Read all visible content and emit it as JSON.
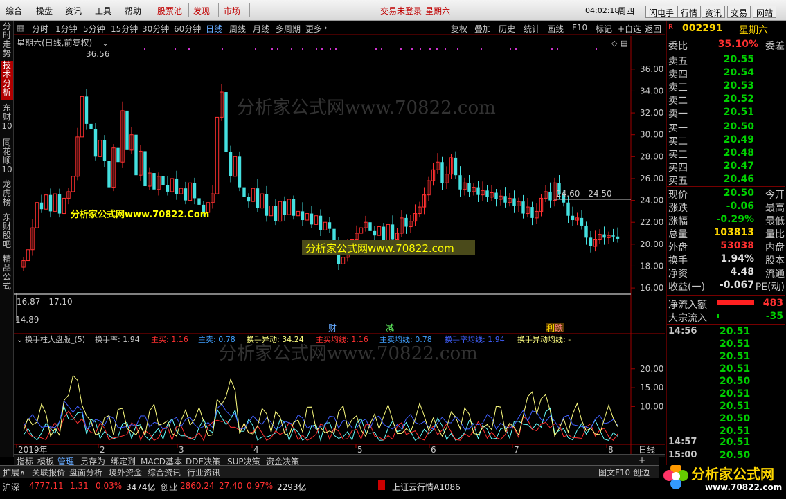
{
  "menu": {
    "items": [
      "综合",
      "操盘",
      "资讯",
      "工具",
      "帮助"
    ],
    "red_items": [
      "股票池",
      "发现",
      "市场"
    ],
    "login": "交易未登录",
    "login2": "星期六",
    "time": "04:02:18",
    "weekday": "周四",
    "buttons": [
      "闪电手",
      "行情",
      "资讯",
      "交易",
      "网站"
    ]
  },
  "left_tabs": [
    "分时走势",
    "技术分析",
    "东财10",
    "同花顺10",
    "龙虎榜",
    "东财股吧",
    "精品公式"
  ],
  "periods": [
    "分时",
    "1分钟",
    "5分钟",
    "15分钟",
    "30分钟",
    "60分钟",
    "日线",
    "周线",
    "月线",
    "多周期",
    "更多"
  ],
  "tools": [
    "复权",
    "叠加",
    "历史",
    "统计",
    "画线",
    "F10",
    "标记",
    "+自选",
    "返回"
  ],
  "chart": {
    "title": "星期六(日线,前复权)",
    "max_label": "36.56",
    "min_label": "14.89",
    "range1": "24.60 - 24.50",
    "range2": "16.87 - 17.10",
    "y_ticks": [
      "36.00",
      "34.00",
      "32.00",
      "30.00",
      "28.00",
      "26.00",
      "24.00",
      "22.00",
      "20.00",
      "18.00",
      "16.00"
    ],
    "markers": [
      "财",
      "减",
      "利",
      "跌"
    ],
    "watermark": "分析家公式网www.70822.com",
    "watermark2": "分析家公式网www.70822.Com",
    "x_ticks": [
      "2019年",
      "2",
      "3",
      "4",
      "5",
      "6",
      "7",
      "8"
    ],
    "period_label": "日线"
  },
  "indicator": {
    "name": "换手柱大盘版_(5)",
    "items": [
      "换手率: 1.94",
      "主买: 1.16",
      "主卖: 0.78",
      "换手异动: 34.24",
      "主买均线: 1.16",
      "主卖均线: 0.78",
      "换手率均线: 1.94",
      "换手异动均线: -"
    ],
    "y_ticks": [
      "20.00",
      "15.00",
      "10.00"
    ]
  },
  "right": {
    "code": "002291",
    "name": "星期六",
    "webi_label": "委比",
    "webi_val": "35.10%",
    "wecha": "委差",
    "sells": [
      [
        "卖五",
        "20.55"
      ],
      [
        "卖四",
        "20.54"
      ],
      [
        "卖三",
        "20.53"
      ],
      [
        "卖二",
        "20.52"
      ],
      [
        "卖一",
        "20.51"
      ]
    ],
    "buys": [
      [
        "买一",
        "20.50"
      ],
      [
        "买二",
        "20.49"
      ],
      [
        "买三",
        "20.48"
      ],
      [
        "买四",
        "20.47"
      ],
      [
        "买五",
        "20.46"
      ]
    ],
    "stats": [
      [
        "现价",
        "20.50",
        "今开"
      ],
      [
        "涨跌",
        "-0.06",
        "最高"
      ],
      [
        "涨幅",
        "-0.29%",
        "最低"
      ],
      [
        "总量",
        "103813",
        "量比"
      ],
      [
        "外盘",
        "53038",
        "内盘"
      ],
      [
        "换手",
        "1.94%",
        "股本"
      ],
      [
        "净资",
        "4.48",
        "流通"
      ],
      [
        "收益(一)",
        "-0.067",
        "PE(动)"
      ]
    ],
    "netflow_label": "净流入额",
    "netflow_val": "483",
    "block_label": "大宗流入",
    "block_val": "-35",
    "ticks": [
      [
        "14:56",
        "20.51"
      ],
      [
        "",
        "20.51"
      ],
      [
        "",
        "20.51"
      ],
      [
        "",
        "20.51"
      ],
      [
        "",
        "20.50"
      ],
      [
        "",
        "20.51"
      ],
      [
        "",
        "20.51"
      ],
      [
        "",
        "20.50"
      ],
      [
        "",
        "20.51"
      ],
      [
        "14:57",
        "20.51"
      ],
      [
        "15:00",
        "20.50"
      ]
    ]
  },
  "bottom_tabs": [
    "指标",
    "模板",
    "管理",
    "另存为",
    "绑定到",
    "MACD基本",
    "DDE决策",
    "SUP决策",
    "资金决策"
  ],
  "taskbar": [
    "扩展∧",
    "关联报价",
    "盘面分析",
    "境外资金",
    "综合资讯",
    "行业资讯"
  ],
  "taskbar_right": [
    "图文F10",
    "创边"
  ],
  "status": {
    "sh_label": "沪深",
    "sh_val": "4777.11",
    "sh_chg": "1.31",
    "sh_pct": "0.03%",
    "sh_amt": "3474亿",
    "cy_label": "创业",
    "cy_val": "2860.24",
    "cy_chg": "27.40",
    "cy_pct": "0.97%",
    "cy_amt": "2293亿",
    "news": "上证云行情A1086",
    "logo": "分析家公式网",
    "logo_url": "www.70822.com"
  },
  "chart_data": {
    "type": "candlestick",
    "title": "星期六(日线,前复权)",
    "ylim": [
      15.5,
      37
    ],
    "closes": [
      18.5,
      19.5,
      21.5,
      23.8,
      23.2,
      24.5,
      23.0,
      24.6,
      22.8,
      24.2,
      24.8,
      26.2,
      29.8,
      33.5,
      31.0,
      30.5,
      28.0,
      29.5,
      27.6,
      25.2,
      28.8,
      27.5,
      32.2,
      28.6,
      30.0,
      26.3,
      28.5,
      25.3,
      26.5,
      25.0,
      26.2,
      25.4,
      24.8,
      26.0,
      24.6,
      25.1,
      24.0,
      25.6,
      24.2,
      23.6,
      22.9,
      23.8,
      24.6,
      31.6,
      33.9,
      28.4,
      26.2,
      28.0,
      25.2,
      24.3,
      23.9,
      25.1,
      23.3,
      24.6,
      22.6,
      23.5,
      22.1,
      23.9,
      22.7,
      24.1,
      22.6,
      23.0,
      22.2,
      22.8,
      21.8,
      22.6,
      21.3,
      22.0,
      21.4,
      20.3,
      18.2,
      18.8,
      19.6,
      20.4,
      21.0,
      21.5,
      22.0,
      21.2,
      20.8,
      21.6,
      20.2,
      21.8,
      20.4,
      21.0,
      22.4,
      21.6,
      22.1,
      22.8,
      23.4,
      24.5,
      25.8,
      26.8,
      27.5,
      25.6,
      26.4,
      27.9,
      26.3,
      25.0,
      25.6,
      24.8,
      25.2,
      24.5,
      24.9,
      24.3,
      24.7,
      24.1,
      24.4,
      23.8,
      24.2,
      23.5,
      23.9,
      22.8,
      23.4,
      22.4,
      23.0,
      24.2,
      24.8,
      24.0,
      25.6,
      24.6,
      23.8,
      22.6,
      22.2,
      22.4,
      21.7,
      20.6,
      19.8,
      20.4,
      20.9,
      20.6,
      20.8,
      20.7,
      20.5
    ],
    "indicator_series": [
      {
        "name": "换手率",
        "color": "#66ffff"
      },
      {
        "name": "主买",
        "color": "#ff3030"
      },
      {
        "name": "主卖",
        "color": "#4060ff"
      },
      {
        "name": "换手异动",
        "color": "#ffff80"
      }
    ]
  }
}
